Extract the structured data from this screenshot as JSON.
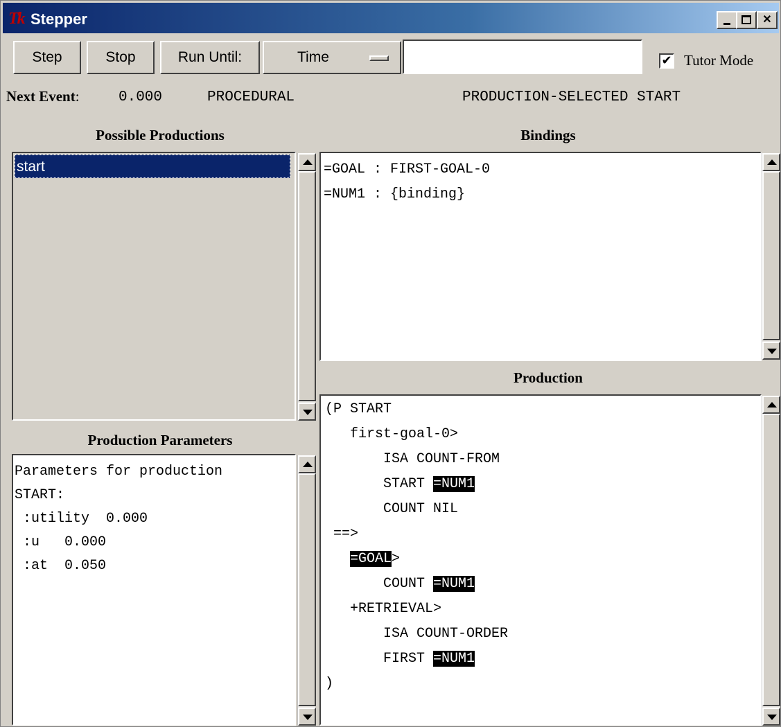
{
  "window": {
    "title": "Stepper",
    "logo": "Tk",
    "controls": {
      "minimize": "minimize-icon",
      "maximize": "maximize-icon",
      "close": "close-icon"
    }
  },
  "toolbar": {
    "step_label": "Step",
    "stop_label": "Stop",
    "run_until_label": "Run Until:",
    "run_until_option": "Time",
    "run_until_value": "",
    "tutor_mode_label": "Tutor Mode",
    "tutor_mode_checked": true,
    "tutor_mode_check": "✔"
  },
  "next_event": {
    "label": "Next Event",
    "colon": ":",
    "time": "0.000",
    "module": "PROCEDURAL",
    "action": "PRODUCTION-SELECTED START"
  },
  "possible_productions": {
    "header": "Possible Productions",
    "items": [
      "start"
    ],
    "selected": "start"
  },
  "bindings": {
    "header": "Bindings",
    "lines": [
      "=GOAL : FIRST-GOAL-0",
      "=NUM1 : {binding}"
    ]
  },
  "production_parameters": {
    "header": "Production Parameters",
    "lines": [
      "Parameters for production",
      "START:",
      " :utility  0.000",
      " :u   0.000",
      " :at  0.050"
    ]
  },
  "production": {
    "header": "Production",
    "lines": [
      {
        "pre": "(P START",
        "hl": "",
        "post": ""
      },
      {
        "pre": "   first-goal-0>",
        "hl": "",
        "post": ""
      },
      {
        "pre": "       ISA COUNT-FROM",
        "hl": "",
        "post": ""
      },
      {
        "pre": "       START ",
        "hl": "=NUM1",
        "post": ""
      },
      {
        "pre": "       COUNT NIL",
        "hl": "",
        "post": ""
      },
      {
        "pre": " ==>",
        "hl": "",
        "post": ""
      },
      {
        "pre": "   ",
        "hl": "=GOAL",
        "post": ">"
      },
      {
        "pre": "       COUNT ",
        "hl": "=NUM1",
        "post": ""
      },
      {
        "pre": "   +RETRIEVAL>",
        "hl": "",
        "post": ""
      },
      {
        "pre": "       ISA COUNT-ORDER",
        "hl": "",
        "post": ""
      },
      {
        "pre": "       FIRST ",
        "hl": "=NUM1",
        "post": ""
      },
      {
        "pre": ")",
        "hl": "",
        "post": ""
      }
    ]
  }
}
